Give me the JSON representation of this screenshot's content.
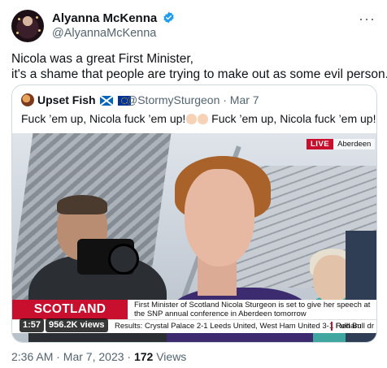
{
  "author": {
    "name": "Alyanna McKenna",
    "handle": "@AlyannaMcKenna"
  },
  "tweet": {
    "line1": "Nicola was a great First Minister,",
    "line2": "it's a shame that people are trying to make out as some evil person."
  },
  "quote": {
    "name": "Upset Fish",
    "handle": "@StormySturgeon · Mar 7",
    "text_part1": "Fuck ’em up, Nicola fuck ’em up!",
    "text_part2": " Fuck ’em up, Nicola fuck ’em up!",
    "video": {
      "live_label": "LIVE",
      "location": "Aberdeen",
      "chyron_brand": "SCOTLAND FUTURE",
      "chyron_story": "First Minister of Scotland Nicola Sturgeon is set to give her speech at the SNP annual conference in Aberdeen tomorrow",
      "ticker_text": "Results: Crystal Palace 2-1 Leeds United, West Ham United 3-1 Fulham",
      "ticker_text2": "Red Bull dr",
      "duration": "1:57",
      "views": "956.2K views"
    }
  },
  "footer": {
    "timestamp": "2:36 AM · Mar 7, 2023 · ",
    "views_count": "172",
    "views_label": " Views"
  },
  "colors": {
    "verified": "#1d9bf0",
    "live_red": "#c8102e",
    "muted_text": "#536471",
    "border": "#cfd9de"
  },
  "icons": [
    "verified-icon",
    "more-icon",
    "scotland-flag-icon",
    "eu-flag-icon",
    "clap-emoji-icon"
  ]
}
